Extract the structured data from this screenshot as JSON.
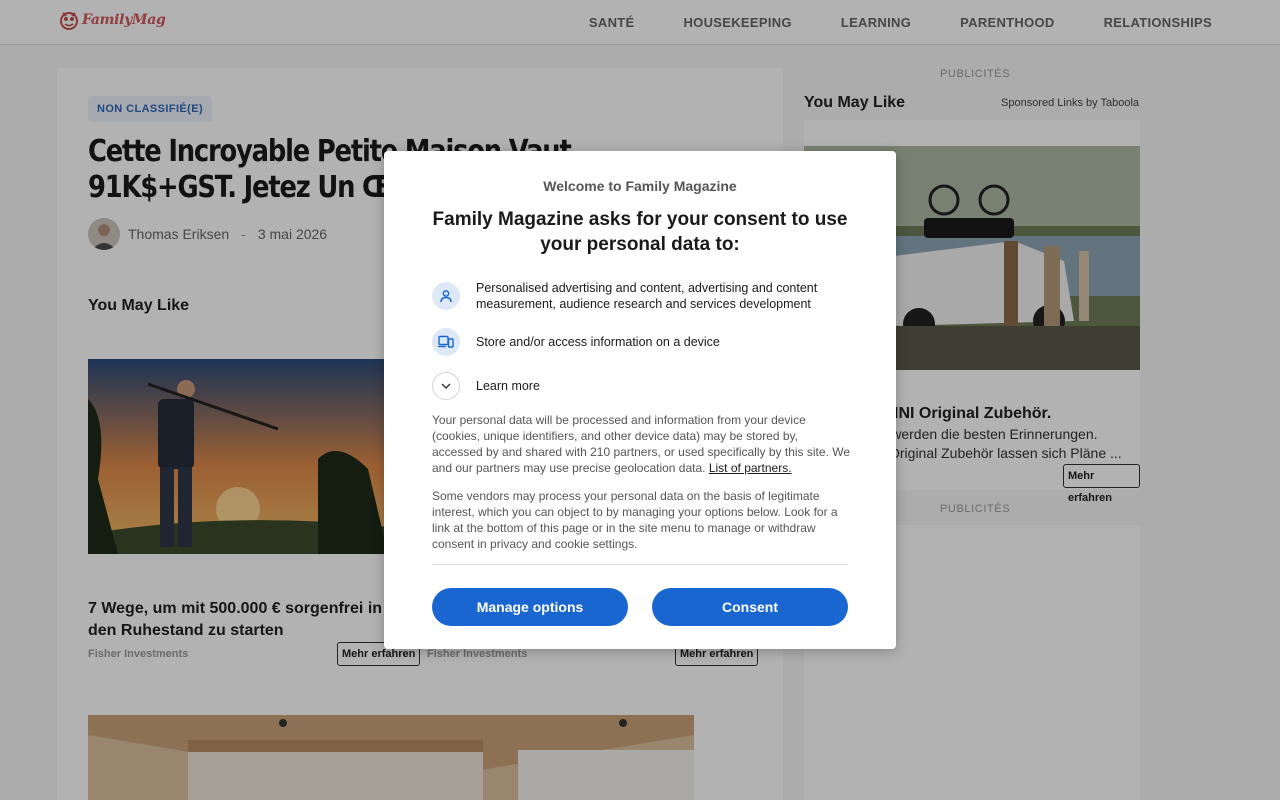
{
  "header": {
    "logo_text": "FamilyMag",
    "nav": [
      "SANTÉ",
      "HOUSEKEEPING",
      "LEARNING",
      "PARENTHOOD",
      "RELATIONSHIPS"
    ]
  },
  "article": {
    "category": "NON CLASSIFIÉ(E)",
    "title": "Cette Incroyable Petite Maison Vaut 91K$+GST. Jetez Un Œil À L’Intérieur !",
    "author": "Thomas Eriksen",
    "separator": "-",
    "date": "3 mai 2026",
    "section_heading": "You May Like",
    "promos": [
      {
        "caption": "7 Wege, um mit 500.000 € sorgenfrei in den Ruhestand zu starten",
        "source": "Fisher Investments",
        "cta": "Mehr erfahren"
      },
      {
        "source": "Fisher Investments",
        "cta": "Mehr erfahren"
      }
    ]
  },
  "sidebar": {
    "pub_label": "PUBLICITÉS",
    "heading": "You May Like",
    "sponsored": "Sponsored Links by Taboola",
    "ad_title": "INI Original Zubehör.",
    "ad_text_line1": "nen werden die besten Erinnerungen.",
    "ad_text_line2": "Original Zubehör lassen sich Pläne ...",
    "ad_cta": "Mehr erfahren",
    "pub_label_2": "PUBLICITÉS"
  },
  "consent": {
    "welcome": "Welcome to Family Magazine",
    "title": "Family Magazine asks for your consent to use your personal data to:",
    "purposes": [
      {
        "icon": "person-icon",
        "text": "Personalised advertising and content, advertising and content measurement, audience research and services development"
      },
      {
        "icon": "devices-icon",
        "text": "Store and/or access information on a device"
      }
    ],
    "learn_more": "Learn more",
    "paragraph1": "Your personal data will be processed and information from your device (cookies, unique identifiers, and other device data) may be stored by, accessed by and shared with 210 partners, or used specifically by this site. We and our partners may use precise geolocation data.",
    "partners_link": "List of partners.",
    "paragraph2": "Some vendors may process your personal data on the basis of legitimate interest, which you can object to by managing your options below. Look for a link at the bottom of this page or in the site menu to manage or withdraw consent in privacy and cookie settings.",
    "manage_button": "Manage options",
    "consent_button": "Consent",
    "accent_color": "#1a66d0"
  }
}
